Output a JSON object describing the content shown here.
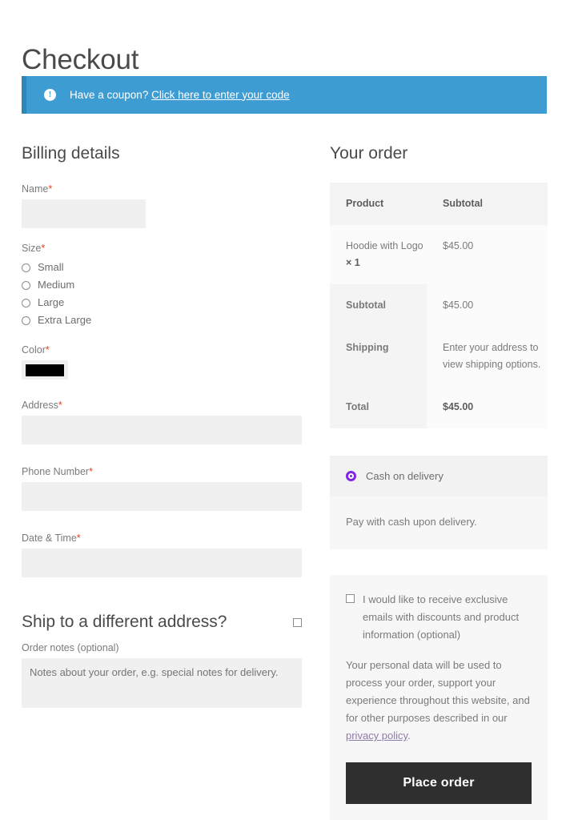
{
  "page": {
    "title": "Checkout"
  },
  "coupon_notice": {
    "icon": "info-circle-icon",
    "text": "Have a coupon?",
    "link_label": "Click here to enter your code",
    "background_color": "#3d9cd2",
    "border_color": "#2e85b8"
  },
  "billing": {
    "heading": "Billing details",
    "required_mark": "*",
    "fields": [
      {
        "label": "Name",
        "required": true,
        "value": "",
        "placeholder": ""
      },
      {
        "label": "Address",
        "required": true,
        "value": "",
        "placeholder": ""
      },
      {
        "label": "Phone Number",
        "required": true,
        "value": "",
        "placeholder": ""
      },
      {
        "label": "Date & Time",
        "required": true,
        "value": "",
        "placeholder": ""
      }
    ],
    "size": {
      "label": "Size",
      "required": true,
      "options": [
        {
          "label": "Small",
          "selected": false
        },
        {
          "label": "Medium",
          "selected": false
        },
        {
          "label": "Large",
          "selected": false
        },
        {
          "label": "Extra Large",
          "selected": false
        }
      ]
    },
    "color": {
      "label": "Color",
      "required": true,
      "swatch_color": "#000000"
    }
  },
  "ship_to_different": {
    "title": "Ship to a different address?",
    "checked": false
  },
  "order_notes": {
    "label": "Order notes (optional)",
    "value": "",
    "placeholder": "Notes about your order, e.g. special notes for delivery."
  },
  "order": {
    "heading": "Your order",
    "columns": {
      "product": "Product",
      "subtotal": "Subtotal"
    },
    "items": [
      {
        "name": "Hoodie with Logo",
        "quantity": "× 1",
        "subtotal": "$45.00"
      }
    ],
    "totals": [
      {
        "label": "Subtotal",
        "value": "$45.00",
        "strong": false
      },
      {
        "label": "Shipping",
        "value": "Enter your address to view shipping options.",
        "strong": false
      },
      {
        "label": "Total",
        "value": "$45.00",
        "strong": true
      }
    ]
  },
  "payment": {
    "method_label": "Cash on delivery",
    "selected": true,
    "accent_color": "#8224e3",
    "description": "Pay with cash upon delivery."
  },
  "submit": {
    "marketing_checkbox": {
      "label": "I would like to receive exclusive emails with discounts and product information (optional)",
      "checked": false
    },
    "privacy_text_before": "Your personal data will be used to process your order, support your experience throughout this website, and for other purposes described in our ",
    "privacy_link_label": "privacy policy",
    "privacy_text_after": ".",
    "place_order_label": "Place order"
  }
}
